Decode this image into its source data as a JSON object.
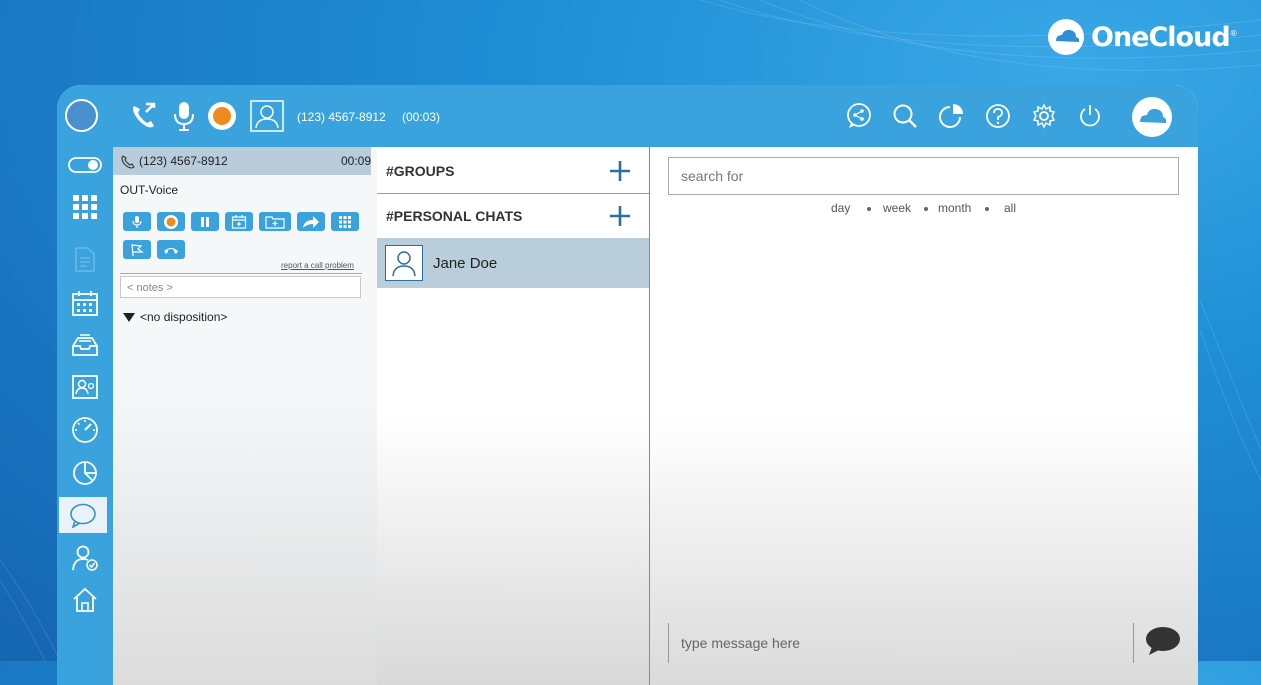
{
  "brand": {
    "name": "OneCloud",
    "trademark": "®"
  },
  "topbar": {
    "phone_number": "(123) 4567-8912",
    "call_timer": "(00:03)"
  },
  "call": {
    "number": "(123) 4567-8912",
    "duration": "00:09",
    "type": "OUT-Voice",
    "report_link": "report a call problem",
    "notes_placeholder": "< notes >",
    "disposition": "<no disposition>"
  },
  "chats": {
    "groups_label": "#GROUPS",
    "personal_label": "#PERSONAL CHATS",
    "contacts": [
      {
        "name": "Jane Doe"
      }
    ]
  },
  "messages": {
    "search_placeholder": "search for",
    "filters": [
      "day",
      "week",
      "month",
      "all"
    ],
    "compose_placeholder": "type message here"
  },
  "colors": {
    "accent": "#3aa3de",
    "header_bg": "#b8ccdb",
    "selected_row": "#b9cddb",
    "record": "#f08a1c",
    "icon_dark": "#1e5a8c"
  }
}
